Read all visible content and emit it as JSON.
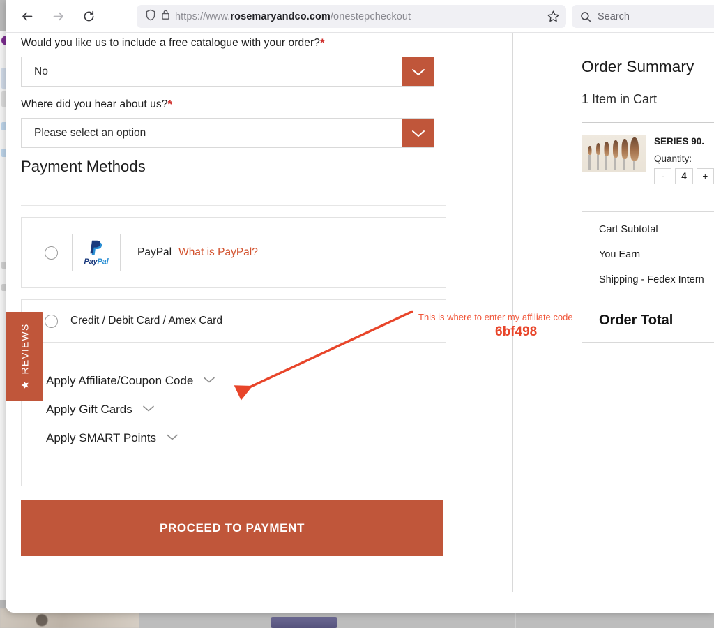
{
  "browser": {
    "back_icon": "arrow-left-icon",
    "forward_icon": "arrow-right-icon",
    "reload_icon": "reload-icon",
    "shield_icon": "shield-icon",
    "lock_icon": "padlock-icon",
    "bookmark_icon": "star-outline-icon",
    "search_icon": "magnifier-icon",
    "url_scheme": "https://www.",
    "url_host": "rosemaryandco.com",
    "url_path": "/onestepcheckout",
    "search_placeholder": "Search"
  },
  "checkout": {
    "catalogue_question": "Would you like us to include a free catalogue with your order?",
    "catalogue_value": "No",
    "hear_about_question": "Where did you hear about us?",
    "hear_about_value": "Please select an option",
    "required_marker": "*",
    "section_title": "Payment Methods",
    "payment_methods": [
      {
        "id": "paypal",
        "label": "PayPal",
        "link_label": "What is PayPal?",
        "logo": "paypal-logo",
        "logo_text_a": "Pay",
        "logo_text_b": "Pal",
        "selected": false
      },
      {
        "id": "card",
        "label": "Credit / Debit Card / Amex Card",
        "selected": false
      }
    ],
    "code_sections": [
      {
        "label": "Apply Affiliate/Coupon Code",
        "icon": "chevron-down-icon"
      },
      {
        "label": "Apply Gift Cards",
        "icon": "chevron-down-icon"
      },
      {
        "label": "Apply SMART Points",
        "icon": "chevron-down-icon"
      }
    ],
    "proceed_label": "PROCEED TO PAYMENT"
  },
  "reviews_tab": {
    "label": "REVIEWS",
    "icon": "star-icon"
  },
  "order_summary": {
    "title": "Order Summary",
    "cart_count": "1 Item in Cart",
    "item": {
      "name": "SERIES 90.",
      "thumb": "paintbrush-set-photo",
      "quantity_label": "Quantity:",
      "decrement_label": "-",
      "quantity_value": "4",
      "increment_label": "+"
    },
    "totals": [
      "Cart Subtotal",
      "You Earn",
      "Shipping - Fedex Intern"
    ],
    "grand_total_label": "Order Total"
  },
  "annotation": {
    "text": "This is where to enter my affiliate code",
    "code": "6bf498",
    "color": "#ea4a2c"
  },
  "theme": {
    "accent": "#c0563a",
    "link": "#d2512d",
    "required": "#d0312d"
  }
}
